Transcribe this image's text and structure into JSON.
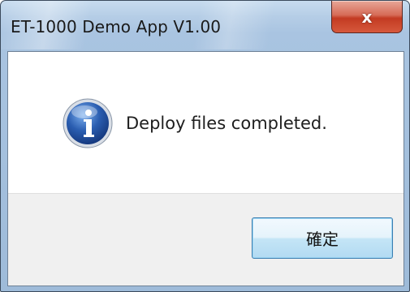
{
  "window": {
    "title": "ET-1000 Demo App V1.00",
    "close_label": "x"
  },
  "dialog": {
    "icon": "info-icon",
    "message": "Deploy files completed.",
    "ok_label": "確定"
  },
  "colors": {
    "frame": "#b5cde6",
    "close_button": "#c33b22",
    "info_icon": "#2a5db0",
    "footer": "#f0f0f0",
    "ok_border": "#3c7fb1"
  }
}
